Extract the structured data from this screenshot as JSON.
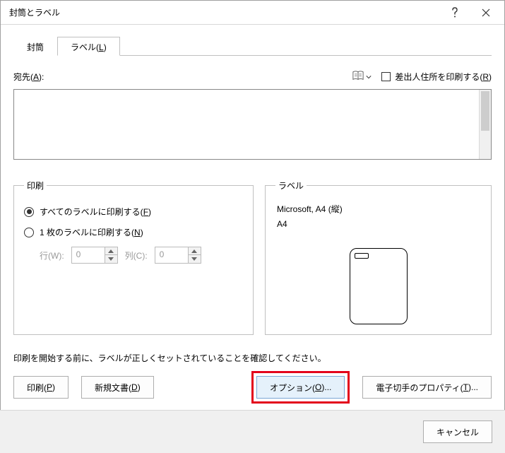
{
  "titlebar": {
    "title": "封筒とラベル",
    "help_aria": "Help",
    "close_aria": "Close"
  },
  "tabs": {
    "envelopes": "封筒",
    "labels_prefix": "ラベル(",
    "labels_key": "L",
    "labels_suffix": ")"
  },
  "address": {
    "label_prefix": "宛先(",
    "label_key": "A",
    "label_suffix": "):",
    "return_prefix": "差出人住所を印刷する(",
    "return_key": "R",
    "return_suffix": ")",
    "value": ""
  },
  "print_fs": {
    "legend": "印刷",
    "all_prefix": "すべてのラベルに印刷する(",
    "all_key": "F",
    "all_suffix": ")",
    "single_prefix": "1 枚のラベルに印刷する(",
    "single_key": "N",
    "single_suffix": ")",
    "row_label": "行(W):",
    "row_value": "0",
    "col_label": "列(C):",
    "col_value": "0"
  },
  "label_fs": {
    "legend": "ラベル",
    "vendor_product": "Microsoft, A4 (縦)",
    "detail": "A4"
  },
  "instruction": "印刷を開始する前に、ラベルが正しくセットされていることを確認してください。",
  "buttons": {
    "print_prefix": "印刷(",
    "print_key": "P",
    "print_suffix": ")",
    "newdoc_prefix": "新規文書(",
    "newdoc_key": "D",
    "newdoc_suffix": ")",
    "options_prefix": "オプション(",
    "options_key": "O",
    "options_suffix": ")...",
    "epostage_prefix": "電子切手のプロパティ(",
    "epostage_key": "T",
    "epostage_suffix": ")...",
    "cancel": "キャンセル"
  }
}
